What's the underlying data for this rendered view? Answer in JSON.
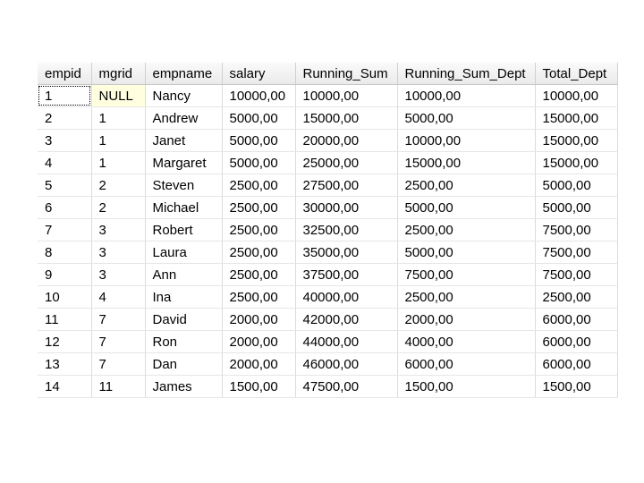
{
  "columns": [
    "empid",
    "mgrid",
    "empname",
    "salary",
    "Running_Sum",
    "Running_Sum_Dept",
    "Total_Dept"
  ],
  "rows": [
    [
      "1",
      "NULL",
      "Nancy",
      "10000,00",
      "10000,00",
      "10000,00",
      "10000,00"
    ],
    [
      "2",
      "1",
      "Andrew",
      "5000,00",
      "15000,00",
      "5000,00",
      "15000,00"
    ],
    [
      "3",
      "1",
      "Janet",
      "5000,00",
      "20000,00",
      "10000,00",
      "15000,00"
    ],
    [
      "4",
      "1",
      "Margaret",
      "5000,00",
      "25000,00",
      "15000,00",
      "15000,00"
    ],
    [
      "5",
      "2",
      "Steven",
      "2500,00",
      "27500,00",
      "2500,00",
      "5000,00"
    ],
    [
      "6",
      "2",
      "Michael",
      "2500,00",
      "30000,00",
      "5000,00",
      "5000,00"
    ],
    [
      "7",
      "3",
      "Robert",
      "2500,00",
      "32500,00",
      "2500,00",
      "7500,00"
    ],
    [
      "8",
      "3",
      "Laura",
      "2500,00",
      "35000,00",
      "5000,00",
      "7500,00"
    ],
    [
      "9",
      "3",
      "Ann",
      "2500,00",
      "37500,00",
      "7500,00",
      "7500,00"
    ],
    [
      "10",
      "4",
      "Ina",
      "2500,00",
      "40000,00",
      "2500,00",
      "2500,00"
    ],
    [
      "11",
      "7",
      "David",
      "2000,00",
      "42000,00",
      "2000,00",
      "6000,00"
    ],
    [
      "12",
      "7",
      "Ron",
      "2000,00",
      "44000,00",
      "4000,00",
      "6000,00"
    ],
    [
      "13",
      "7",
      "Dan",
      "2000,00",
      "46000,00",
      "6000,00",
      "6000,00"
    ],
    [
      "14",
      "11",
      "James",
      "1500,00",
      "47500,00",
      "1500,00",
      "1500,00"
    ]
  ],
  "null_cell_color": "#ffffe0"
}
